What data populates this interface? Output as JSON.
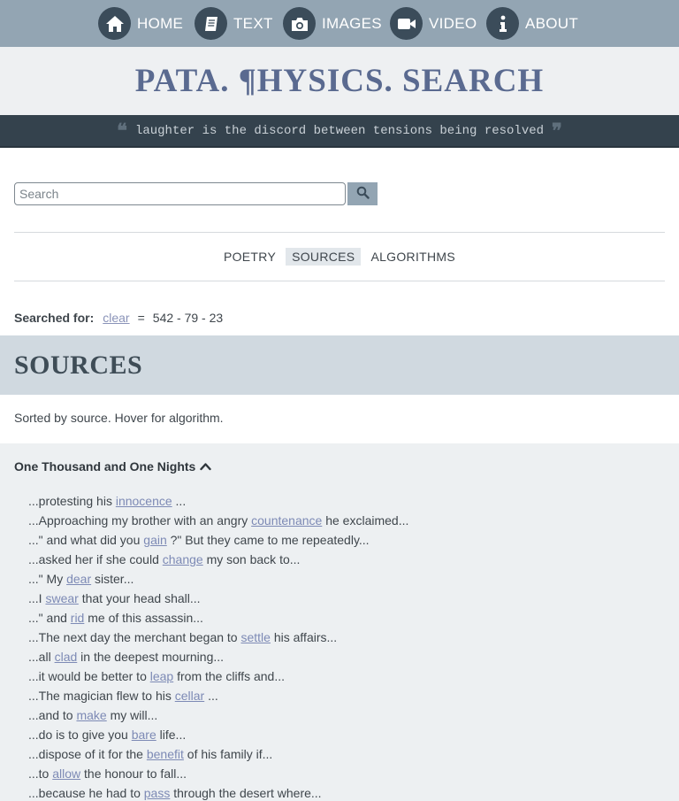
{
  "nav": [
    {
      "label": "HOME",
      "icon": "home-icon"
    },
    {
      "label": "TEXT",
      "icon": "book-icon"
    },
    {
      "label": "IMAGES",
      "icon": "camera-icon"
    },
    {
      "label": "VIDEO",
      "icon": "video-camera-icon"
    },
    {
      "label": "ABOUT",
      "icon": "info-icon"
    }
  ],
  "brand": {
    "title": "PATA. ¶HYSICS. SEARCH"
  },
  "quote": {
    "open": "❝",
    "text": "laughter is the discord between tensions being resolved",
    "close": "❞"
  },
  "search": {
    "placeholder": "Search",
    "value": ""
  },
  "tabs": [
    {
      "label": "POETRY",
      "active": false
    },
    {
      "label": "SOURCES",
      "active": true
    },
    {
      "label": "ALGORITHMS",
      "active": false
    }
  ],
  "searched": {
    "label": "Searched for:",
    "term": "clear",
    "eq": "=",
    "counts": "542 - 79 - 23"
  },
  "sources": {
    "title": "SOURCES",
    "note": "Sorted by source. Hover for algorithm."
  },
  "results": {
    "group_title": "One Thousand and One Nights",
    "snippets": [
      {
        "pre": "...protesting his ",
        "kw": "innocence",
        "post": " ..."
      },
      {
        "pre": "...Approaching my brother with an angry ",
        "kw": "countenance",
        "post": " he exclaimed..."
      },
      {
        "pre": "...\" and what did you ",
        "kw": "gain",
        "post": " ?\" But they came to me repeatedly..."
      },
      {
        "pre": "...asked her if she could ",
        "kw": "change",
        "post": " my son back to..."
      },
      {
        "pre": "...\" My ",
        "kw": "dear",
        "post": " sister..."
      },
      {
        "pre": "...I ",
        "kw": "swear",
        "post": " that your head shall..."
      },
      {
        "pre": "...\" and ",
        "kw": "rid",
        "post": " me of this assassin..."
      },
      {
        "pre": "...The next day the merchant began to ",
        "kw": "settle",
        "post": " his affairs..."
      },
      {
        "pre": "...all ",
        "kw": "clad",
        "post": " in the deepest mourning..."
      },
      {
        "pre": "...it would be better to ",
        "kw": "leap",
        "post": " from the cliffs and..."
      },
      {
        "pre": "...The magician flew to his ",
        "kw": "cellar",
        "post": " ..."
      },
      {
        "pre": "...and to ",
        "kw": "make",
        "post": " my will..."
      },
      {
        "pre": "...do is to give you ",
        "kw": "bare",
        "post": " life..."
      },
      {
        "pre": "...dispose of it for the ",
        "kw": "benefit",
        "post": " of his family if..."
      },
      {
        "pre": "...to ",
        "kw": "allow",
        "post": " the honour to fall..."
      },
      {
        "pre": "...because he had to ",
        "kw": "pass",
        "post": " through the desert where..."
      }
    ]
  },
  "colors": {
    "nav_bg": "#93a5b3",
    "nav_icon_bg": "#3b4c5a",
    "brand_title": "#5a6a90",
    "quote_bg": "#34424d",
    "sources_bg": "#d0d9e0",
    "link": "#7d8ab5"
  }
}
